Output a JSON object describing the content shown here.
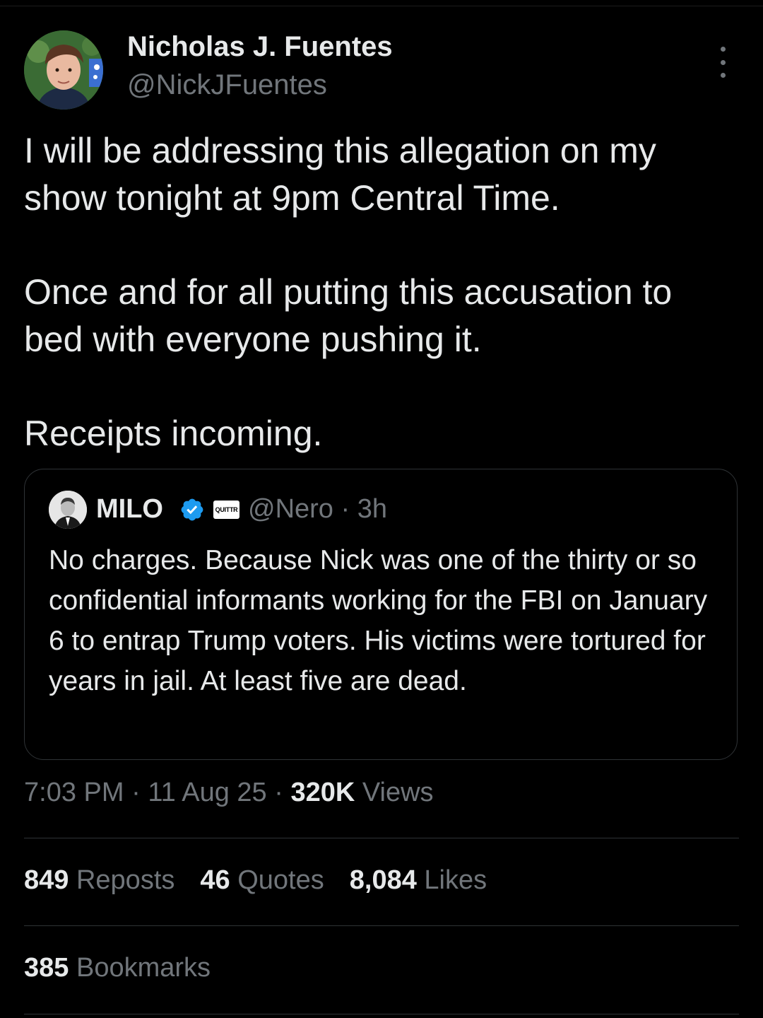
{
  "author": {
    "name": "Nicholas J. Fuentes",
    "handle": "@NickJFuentes"
  },
  "tweet": {
    "paragraphs": [
      "I will be addressing this allegation on my show tonight at 9pm Central Time.",
      "Once and for all putting this accusation to bed with everyone pushing it.",
      "Receipts incoming."
    ]
  },
  "quoted": {
    "name": "MILO",
    "badge_text": "QUITTR",
    "handle": "@Nero",
    "separator": "·",
    "time": "3h",
    "text": "No charges. Because Nick was one of the thirty or so confidential informants working for the FBI on January 6 to entrap Trump voters. His victims were tortured for years in jail. At least five are dead."
  },
  "meta": {
    "time": "7:03 PM",
    "separator": "·",
    "date": "11 Aug 25",
    "views_count": "320K",
    "views_label": "Views"
  },
  "stats": {
    "reposts_count": "849",
    "reposts_label": "Reposts",
    "quotes_count": "46",
    "quotes_label": "Quotes",
    "likes_count": "8,084",
    "likes_label": "Likes",
    "bookmarks_count": "385",
    "bookmarks_label": "Bookmarks"
  },
  "icons": {
    "more": "more-vertical-icon",
    "verified": "verified-badge-icon"
  },
  "colors": {
    "background": "#000000",
    "text_primary": "#e7e9ea",
    "text_secondary": "#71767b",
    "border": "#2f3336",
    "verified_blue": "#1d9bf0"
  }
}
